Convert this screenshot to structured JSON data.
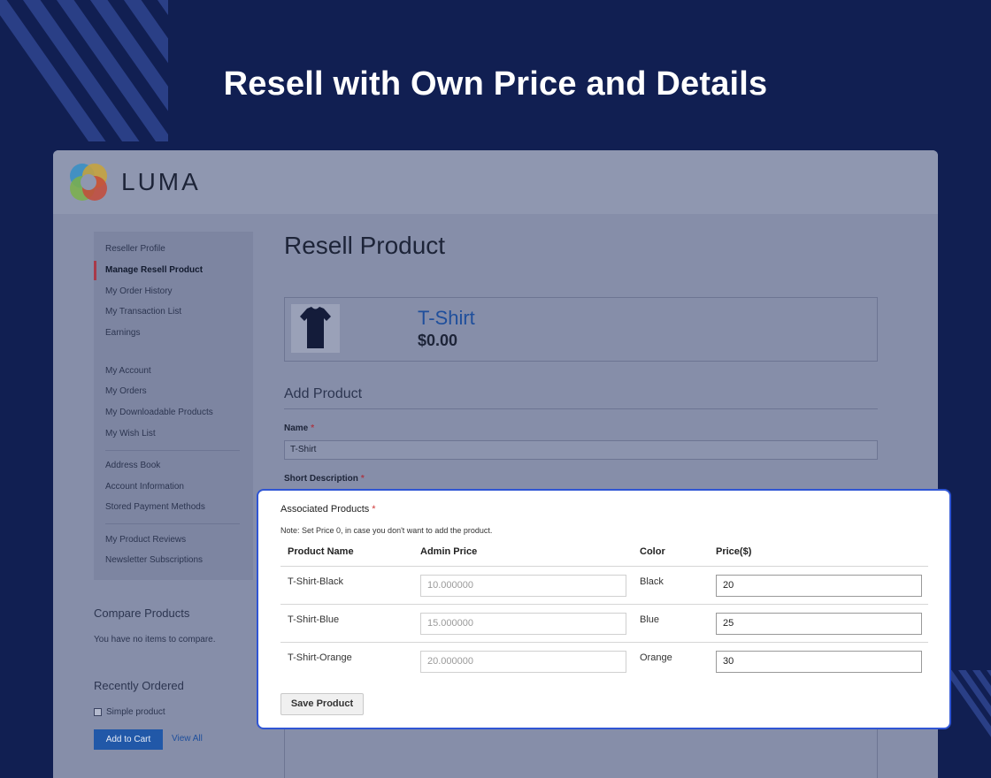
{
  "banner": {
    "title": "Resell with Own Price and Details"
  },
  "store": {
    "logo_text": "LUMA"
  },
  "colors": {
    "background": "#111f52",
    "accent_border": "#2f55d4",
    "link": "#1f4f9c",
    "required": "#d03b3b"
  },
  "sidebar": {
    "items": [
      {
        "label": "Reseller Profile"
      },
      {
        "label": "Manage Resell Product"
      },
      {
        "label": "My Order History"
      },
      {
        "label": "My Transaction List"
      },
      {
        "label": "Earnings"
      },
      {
        "label": "My Account"
      },
      {
        "label": "My Orders"
      },
      {
        "label": "My Downloadable Products"
      },
      {
        "label": "My Wish List"
      },
      {
        "label": "Address Book"
      },
      {
        "label": "Account Information"
      },
      {
        "label": "Stored Payment Methods"
      },
      {
        "label": "My Product Reviews"
      },
      {
        "label": "Newsletter Subscriptions"
      }
    ],
    "active_index": 1
  },
  "compare": {
    "title": "Compare Products",
    "empty_text": "You have no items to compare."
  },
  "recent": {
    "title": "Recently Ordered",
    "item": "Simple product",
    "add_to_cart": "Add to Cart",
    "view_all": "View All"
  },
  "main": {
    "page_title": "Resell Product",
    "product": {
      "name": "T-Shirt",
      "price": "$0.00"
    },
    "add_title": "Add Product",
    "name_label": "Name",
    "name_value": "T-Shirt",
    "short_desc_label": "Short Description",
    "required_mark": "*"
  },
  "associated": {
    "title": "Associated Products",
    "note": "Note: Set Price 0, in case you don't want to add the product.",
    "headers": [
      "Product Name",
      "Admin Price",
      "Color",
      "Price($)"
    ],
    "rows": [
      {
        "name": "T-Shirt-Black",
        "admin_price": "10.000000",
        "color": "Black",
        "price": "20"
      },
      {
        "name": "T-Shirt-Blue",
        "admin_price": "15.000000",
        "color": "Blue",
        "price": "25"
      },
      {
        "name": "T-Shirt-Orange",
        "admin_price": "20.000000",
        "color": "Orange",
        "price": "30"
      }
    ],
    "save_label": "Save Product"
  }
}
